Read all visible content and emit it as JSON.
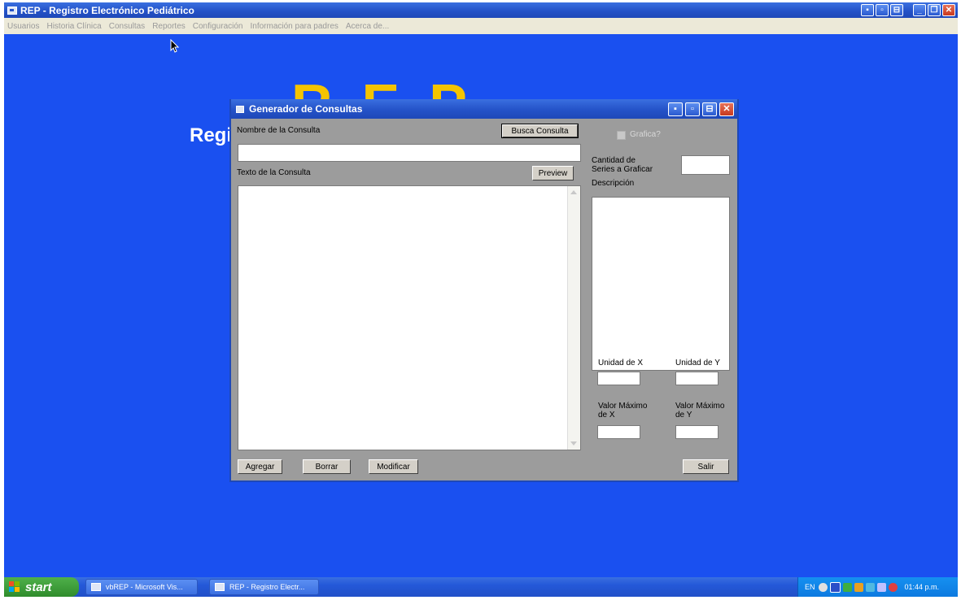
{
  "app": {
    "title": "REP - Registro Electrónico Pediátrico",
    "menu": [
      "Usuarios",
      "Historia Clínica",
      "Consultas",
      "Reportes",
      "Configuración",
      "Información para padres",
      "Acerca de..."
    ]
  },
  "background": {
    "logo_text": "REP",
    "heading": "Registro Electrónico Pediátrico"
  },
  "dialog": {
    "title": "Generador de Consultas",
    "nombre_label": "Nombre de la Consulta",
    "busca_button": "Busca Consulta",
    "nombre_value": "",
    "texto_label": "Texto de la Consulta",
    "preview_button": "Preview",
    "texto_value": "",
    "grafica_label": "Grafica?",
    "cantidad_label": "Cantidad de Series a Graficar",
    "cantidad_value": "",
    "descripcion_label": "Descripción",
    "descripcion_value": "",
    "unidad_x_label": "Unidad de X",
    "unidad_y_label": "Unidad de Y",
    "valor_max_x_label": "Valor Máximo de X",
    "valor_max_y_label": "Valor Máximo de Y",
    "buttons": {
      "agregar": "Agregar",
      "borrar": "Borrar",
      "modificar": "Modificar",
      "salir": "Salir"
    }
  },
  "taskbar": {
    "start": "start",
    "tasks": [
      "vbREP - Microsoft Vis...",
      "REP - Registro Electr..."
    ],
    "language": "EN",
    "clock": "01:44 p.m."
  },
  "colors": {
    "desktop_blue": "#1a50f0",
    "logo_yellow": "#f5c400",
    "dialog_gray": "#9c9c9c",
    "titlebar_blue": "#2452c8",
    "close_red": "#c8391e",
    "start_green": "#2f8c2c"
  }
}
